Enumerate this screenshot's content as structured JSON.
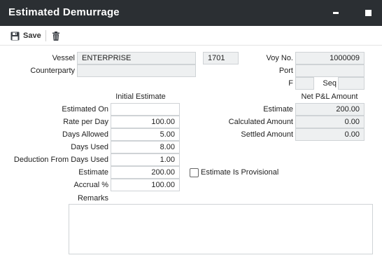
{
  "window": {
    "title": "Estimated Demurrage"
  },
  "toolbar": {
    "save_label": "Save"
  },
  "vessel": {
    "label": "Vessel",
    "name": "ENTERPRISE",
    "code": "1701",
    "voy_label": "Voy No.",
    "voy_no": "1000009",
    "counterparty_label": "Counterparty",
    "counterparty": "",
    "port_label": "Port",
    "port": "",
    "f_label": "F",
    "f": "",
    "seq_label": "Seq",
    "seq": ""
  },
  "initial_estimate": {
    "header": "Initial Estimate",
    "rows": [
      {
        "label": "Estimated On",
        "value": ""
      },
      {
        "label": "Rate per Day",
        "value": "100.00"
      },
      {
        "label": "Days Allowed",
        "value": "5.00"
      },
      {
        "label": "Days Used",
        "value": "8.00"
      },
      {
        "label": "Deduction From Days Used",
        "value": "1.00"
      },
      {
        "label": "Estimate",
        "value": "200.00"
      },
      {
        "label": "Accrual %",
        "value": "100.00"
      }
    ]
  },
  "provisional": {
    "label": "Estimate Is Provisional",
    "checked": false
  },
  "net_pl": {
    "header": "Net P&L Amount",
    "rows": [
      {
        "label": "Estimate",
        "value": "200.00"
      },
      {
        "label": "Calculated Amount",
        "value": "0.00"
      },
      {
        "label": "Settled Amount",
        "value": "0.00"
      }
    ]
  },
  "remarks": {
    "label": "Remarks",
    "value": ""
  },
  "colors": {
    "titlebar": "#2b2f33",
    "readonly_bg": "#eef0f1",
    "border": "#cfd3d6"
  },
  "icons": {
    "save": "floppy-disk-icon",
    "delete": "trash-icon",
    "minimize": "minimize-icon",
    "maximize": "maximize-icon"
  }
}
